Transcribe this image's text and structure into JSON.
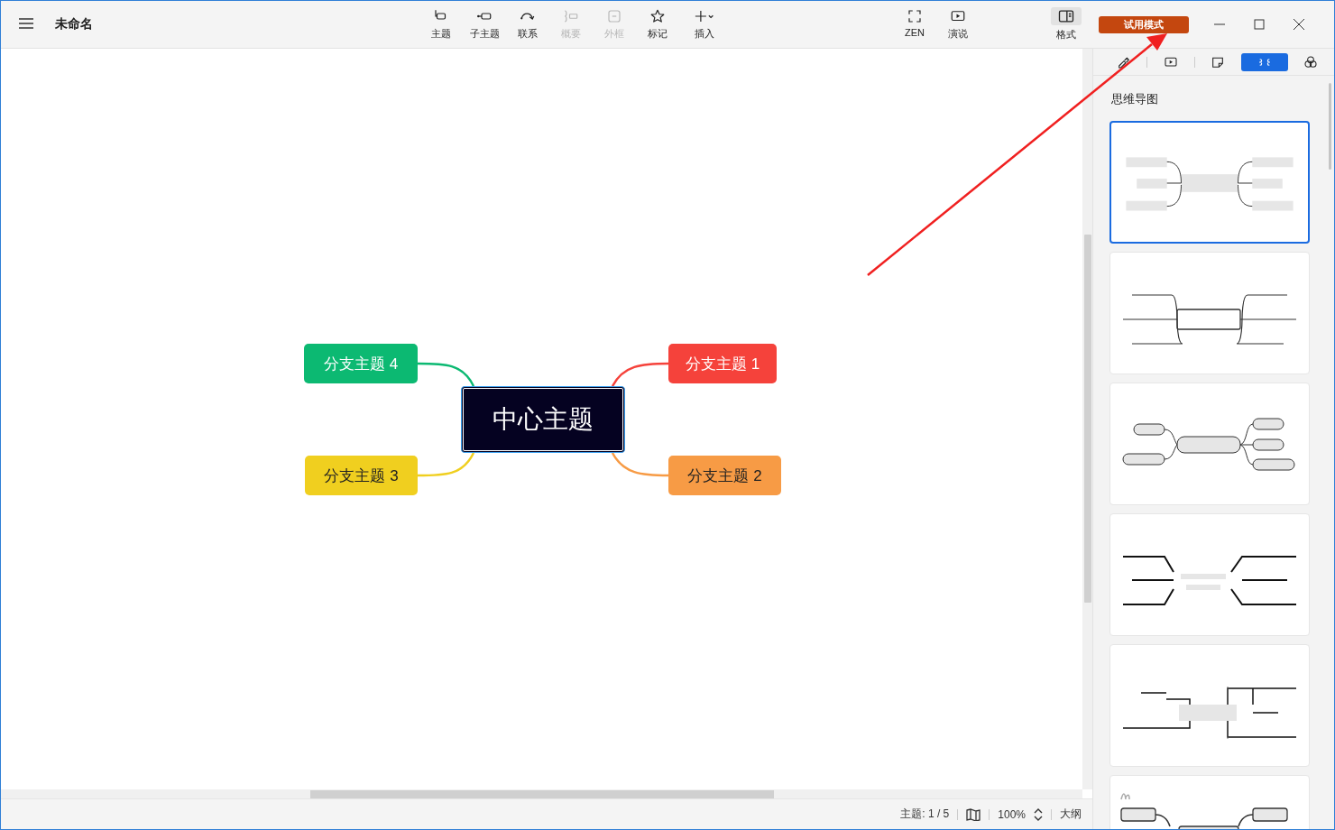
{
  "window": {
    "title": "未命名"
  },
  "toolbar": [
    {
      "kind": "topic",
      "label": "主题",
      "disabled": false
    },
    {
      "kind": "subtopic",
      "label": "子主题",
      "disabled": false
    },
    {
      "kind": "relation",
      "label": "联系",
      "disabled": false
    },
    {
      "kind": "summary",
      "label": "概要",
      "disabled": true
    },
    {
      "kind": "boundary",
      "label": "外框",
      "disabled": true
    },
    {
      "kind": "marker",
      "label": "标记",
      "disabled": false
    },
    {
      "kind": "insert",
      "label": "插入",
      "disabled": false
    }
  ],
  "view_tools": [
    {
      "kind": "zen",
      "label": "ZEN",
      "disabled": false
    },
    {
      "kind": "pitch",
      "label": "演说",
      "disabled": false
    }
  ],
  "format_button": {
    "label": "格式",
    "selected": true
  },
  "trial_button": {
    "label": "试用模式"
  },
  "mind_map": {
    "central": {
      "text": "中心主题"
    },
    "branches": [
      {
        "text": "分支主题 4",
        "color": "#0cb972"
      },
      {
        "text": "分支主题 1",
        "color": "#f5423b"
      },
      {
        "text": "分支主题 3",
        "color": "#f0cf1f"
      },
      {
        "text": "分支主题 2",
        "color": "#f79b45"
      }
    ]
  },
  "status_bar": {
    "topic_count": "主题: 1 / 5",
    "zoom": "100%",
    "outline": "大纲"
  },
  "panel_tabs": [
    {
      "kind": "style",
      "selected": false
    },
    {
      "kind": "pitch",
      "selected": false
    },
    {
      "kind": "note",
      "selected": false
    },
    {
      "kind": "structure",
      "selected": true
    },
    {
      "kind": "theme",
      "selected": false
    }
  ],
  "panel": {
    "heading": "思维导图",
    "layouts": [
      {
        "kind": "mind-map",
        "selected": true
      },
      {
        "kind": "box-brace",
        "selected": false
      },
      {
        "kind": "rounded",
        "selected": false
      },
      {
        "kind": "lines",
        "selected": false
      },
      {
        "kind": "tree",
        "selected": false
      },
      {
        "kind": "hand-drawn",
        "selected": false
      }
    ]
  }
}
